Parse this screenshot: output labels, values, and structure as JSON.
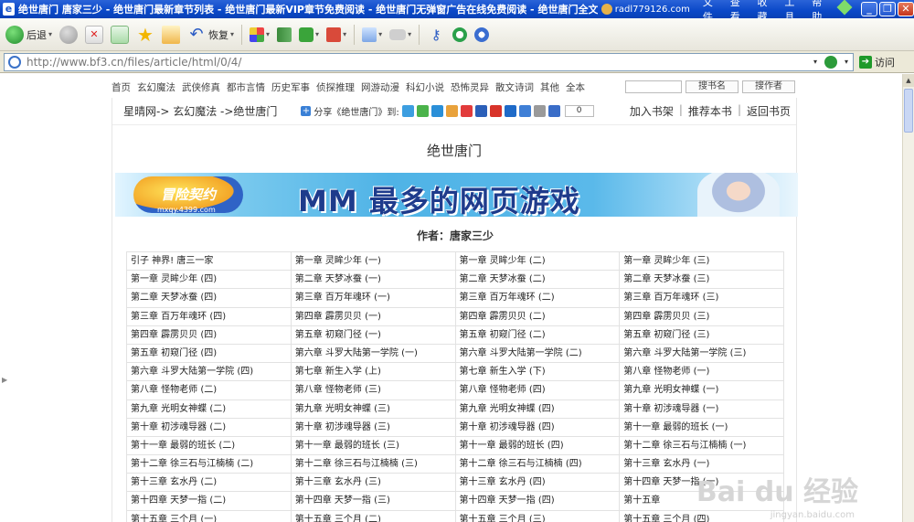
{
  "window": {
    "title": "绝世唐门 唐家三少 - 绝世唐门最新章节列表 - 绝世唐门最新VIP章节免费阅读 - 绝世唐门无弹窗广告在线免费阅读 - 绝世唐门全文章节下载 -",
    "user": "radl779126.com",
    "menus": [
      "文件",
      "查看",
      "收藏",
      "工具",
      "帮助"
    ]
  },
  "toolbar": {
    "back_label": "后退",
    "restore_label": "恢复"
  },
  "address": {
    "url": "http://www.bf3.cn/files/article/html/0/4/",
    "go_label": "访问"
  },
  "nav": {
    "items": [
      "首页",
      "玄幻魔法",
      "武侠修真",
      "都市言情",
      "历史军事",
      "侦探推理",
      "网游动漫",
      "科幻小说",
      "恐怖灵异",
      "散文诗词",
      "其他",
      "全本"
    ],
    "search_name": "搜书名",
    "search_author": "搜作者"
  },
  "crumb": {
    "text": "星晴网-> 玄幻魔法 ->绝世唐门",
    "share_label": "分享《绝世唐门》到:",
    "share_count": "0",
    "actions": [
      "加入书架",
      "推荐本书",
      "返回书页"
    ]
  },
  "book": {
    "title": "绝世唐门",
    "author": "作者：唐家三少"
  },
  "banner": {
    "logo": "冒险契约",
    "sub": "mxqy.4399.com",
    "slogan": "MM 最多的网页游戏"
  },
  "chapters": [
    [
      "引子 神界! 唐三一家",
      "第一章 灵眸少年 (一)",
      "第一章 灵眸少年 (二)",
      "第一章 灵眸少年 (三)"
    ],
    [
      "第一章 灵眸少年 (四)",
      "第二章 天梦冰蚕 (一)",
      "第二章 天梦冰蚕 (二)",
      "第二章 天梦冰蚕 (三)"
    ],
    [
      "第二章 天梦冰蚕 (四)",
      "第三章 百万年魂环 (一)",
      "第三章 百万年魂环 (二)",
      "第三章 百万年魂环 (三)"
    ],
    [
      "第三章 百万年魂环 (四)",
      "第四章 霹雳贝贝 (一)",
      "第四章 霹雳贝贝 (二)",
      "第四章 霹雳贝贝 (三)"
    ],
    [
      "第四章 霹雳贝贝 (四)",
      "第五章 初窥门径 (一)",
      "第五章 初窥门径 (二)",
      "第五章 初窥门径 (三)"
    ],
    [
      "第五章 初窥门径 (四)",
      "第六章 斗罗大陆第一学院 (一)",
      "第六章 斗罗大陆第一学院 (二)",
      "第六章 斗罗大陆第一学院 (三)"
    ],
    [
      "第六章 斗罗大陆第一学院 (四)",
      "第七章 新生入学 (上)",
      "第七章 新生入学 (下)",
      "第八章 怪物老师 (一)"
    ],
    [
      "第八章 怪物老师 (二)",
      "第八章 怪物老师 (三)",
      "第八章 怪物老师 (四)",
      "第九章 光明女神蝶 (一)"
    ],
    [
      "第九章 光明女神蝶 (二)",
      "第九章 光明女神蝶 (三)",
      "第九章 光明女神蝶 (四)",
      "第十章 初涉魂导器 (一)"
    ],
    [
      "第十章 初涉魂导器 (二)",
      "第十章 初涉魂导器 (三)",
      "第十章 初涉魂导器 (四)",
      "第十一章 最弱的班长 (一)"
    ],
    [
      "第十一章 最弱的班长 (二)",
      "第十一章 最弱的班长 (三)",
      "第十一章 最弱的班长 (四)",
      "第十二章 徐三石与江楠楠 (一)"
    ],
    [
      "第十二章 徐三石与江楠楠 (二)",
      "第十二章 徐三石与江楠楠 (三)",
      "第十二章 徐三石与江楠楠 (四)",
      "第十三章 玄水丹 (一)"
    ],
    [
      "第十三章 玄水丹 (二)",
      "第十三章 玄水丹 (三)",
      "第十三章 玄水丹 (四)",
      "第十四章 天梦一指 (一)"
    ],
    [
      "第十四章 天梦一指 (二)",
      "第十四章 天梦一指 (三)",
      "第十四章 天梦一指 (四)",
      "第十五章"
    ],
    [
      "第十五章 三个月 (一)",
      "第十五章 三个月 (二)",
      "第十五章 三个月 (三)",
      "第十五章 三个月 (四)"
    ]
  ],
  "watermark": {
    "main": "Bai du 经验",
    "sub": "jingyan.baidu.com"
  }
}
